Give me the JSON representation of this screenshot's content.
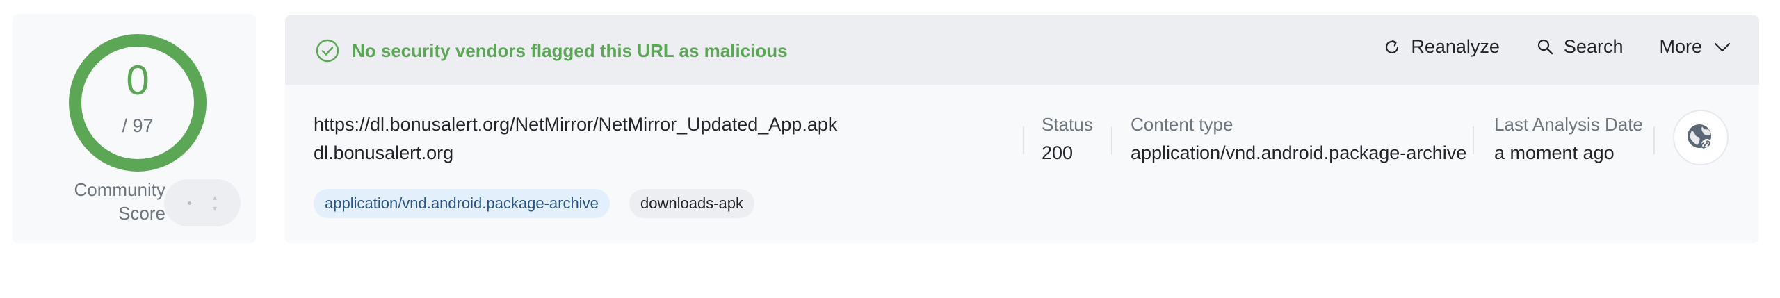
{
  "score": {
    "detections": "0",
    "total": "/ 97",
    "community_label_line1": "Community",
    "community_label_line2": "Score"
  },
  "banner": {
    "message": "No security vendors flagged this URL as malicious",
    "status_color": "#5ba755"
  },
  "actions": [
    {
      "label": "Reanalyze",
      "icon": "refresh-icon"
    },
    {
      "label": "Search",
      "icon": "search-icon"
    },
    {
      "label": "More",
      "icon": "chevron-down-icon"
    }
  ],
  "url": {
    "full": "https://dl.bonusalert.org/NetMirror/NetMirror_Updated_App.apk",
    "host": "dl.bonusalert.org"
  },
  "tags": [
    "application/vnd.android.package-archive",
    "downloads-apk"
  ],
  "meta": {
    "status_label": "Status",
    "status_value": "200",
    "content_type_label": "Content type",
    "content_type_value": "application/vnd.android.package-archive",
    "last_analysis_label": "Last Analysis Date",
    "last_analysis_value": "a moment ago"
  },
  "globe_icon": "globe-link-icon"
}
